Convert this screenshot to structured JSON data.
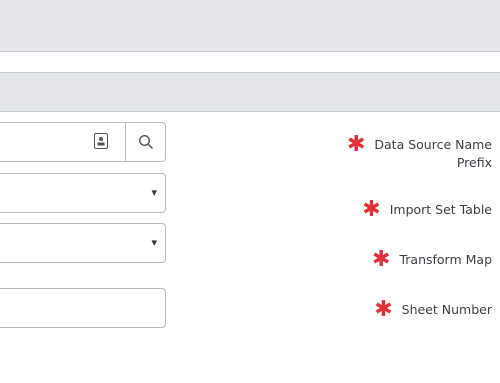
{
  "form": {
    "data_source_name": {
      "label_line1": "Data Source Name",
      "label_line2": "Prefix",
      "required_mark": "✱",
      "value": "",
      "reference_icon": "reference-card-icon",
      "search_icon": "search-icon"
    },
    "import_set_table": {
      "label": "Import Set Table",
      "required_mark": "✱",
      "selected": "",
      "caret": "▾"
    },
    "transform_map": {
      "label": "Transform Map",
      "required_mark": "✱",
      "selected": "",
      "caret": "▾"
    },
    "sheet_number": {
      "label": "Sheet Number",
      "required_mark": "✱",
      "value": ""
    }
  },
  "colors": {
    "required": "#e1303a",
    "bar_background": "#e4e6e9",
    "border": "#b8bcc2"
  }
}
